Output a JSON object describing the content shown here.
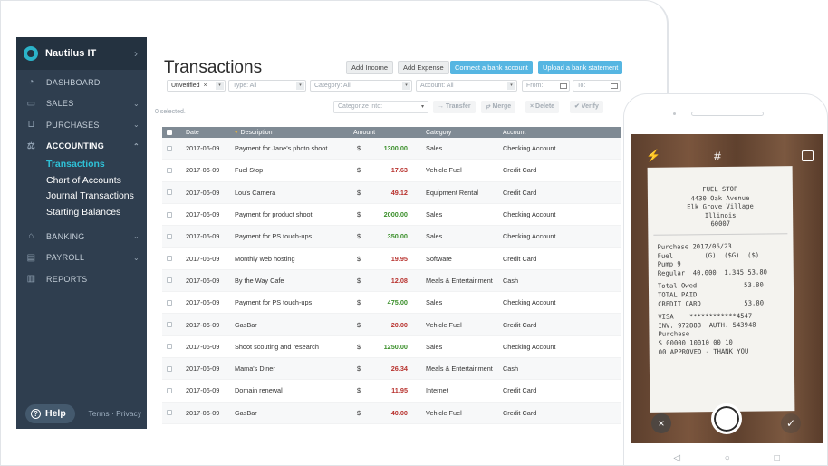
{
  "sidebar": {
    "org_name": "Nautilus IT",
    "nav": [
      {
        "label": "DASHBOARD"
      },
      {
        "label": "SALES"
      },
      {
        "label": "PURCHASES"
      },
      {
        "label": "ACCOUNTING"
      },
      {
        "label": "BANKING"
      },
      {
        "label": "PAYROLL"
      },
      {
        "label": "REPORTS"
      }
    ],
    "accounting_sub": [
      "Transactions",
      "Chart of Accounts",
      "Journal Transactions",
      "Starting Balances"
    ],
    "help_label": "Help",
    "footer_links": "Terms · Privacy"
  },
  "main": {
    "title": "Transactions",
    "buttons": {
      "add_income": "Add Income",
      "add_expense": "Add Expense",
      "connect": "Connect a bank account",
      "upload": "Upload a bank statement"
    },
    "filters": {
      "status": "Unverified",
      "type": "Type: All",
      "category": "Category: All",
      "account": "Account: All",
      "from": "From:",
      "to": "To:"
    },
    "selected_text": "0 selected.",
    "categorize_placeholder": "Categorize into:",
    "bulk_actions": {
      "transfer": "Transfer",
      "merge": "Merge",
      "delete": "Delete",
      "verify": "Verify"
    },
    "columns": [
      "Date",
      "Description",
      "Amount",
      "Category",
      "Account"
    ],
    "rows": [
      {
        "date": "2017-06-09",
        "desc": "Payment for Jane's photo shoot",
        "cur": "$",
        "amount": "1300.00",
        "type": "pos",
        "category": "Sales",
        "account": "Checking Account"
      },
      {
        "date": "2017-06-09",
        "desc": "Fuel Stop",
        "cur": "$",
        "amount": "17.63",
        "type": "neg",
        "category": "Vehicle Fuel",
        "account": "Credit Card"
      },
      {
        "date": "2017-06-09",
        "desc": "Lou's Camera",
        "cur": "$",
        "amount": "49.12",
        "type": "neg",
        "category": "Equipment Rental",
        "account": "Credit Card"
      },
      {
        "date": "2017-06-09",
        "desc": "Payment for product shoot",
        "cur": "$",
        "amount": "2000.00",
        "type": "pos",
        "category": "Sales",
        "account": "Checking Account"
      },
      {
        "date": "2017-06-09",
        "desc": "Payment for PS touch-ups",
        "cur": "$",
        "amount": "350.00",
        "type": "pos",
        "category": "Sales",
        "account": "Checking Account"
      },
      {
        "date": "2017-06-09",
        "desc": "Monthly web hosting",
        "cur": "$",
        "amount": "19.95",
        "type": "neg",
        "category": "Software",
        "account": "Credit Card"
      },
      {
        "date": "2017-06-09",
        "desc": "By the Way Cafe",
        "cur": "$",
        "amount": "12.08",
        "type": "neg",
        "category": "Meals & Entertainment",
        "account": "Cash"
      },
      {
        "date": "2017-06-09",
        "desc": "Payment for PS touch-ups",
        "cur": "$",
        "amount": "475.00",
        "type": "pos",
        "category": "Sales",
        "account": "Checking Account"
      },
      {
        "date": "2017-06-09",
        "desc": "GasBar",
        "cur": "$",
        "amount": "20.00",
        "type": "neg",
        "category": "Vehicle Fuel",
        "account": "Credit Card"
      },
      {
        "date": "2017-06-09",
        "desc": "Shoot scouting and research",
        "cur": "$",
        "amount": "1250.00",
        "type": "pos",
        "category": "Sales",
        "account": "Checking Account"
      },
      {
        "date": "2017-06-09",
        "desc": "Mama's Diner",
        "cur": "$",
        "amount": "26.34",
        "type": "neg",
        "category": "Meals & Entertainment",
        "account": "Cash"
      },
      {
        "date": "2017-06-09",
        "desc": "Domain renewal",
        "cur": "$",
        "amount": "11.95",
        "type": "neg",
        "category": "Internet",
        "account": "Credit Card"
      },
      {
        "date": "2017-06-09",
        "desc": "GasBar",
        "cur": "$",
        "amount": "40.00",
        "type": "neg",
        "category": "Vehicle Fuel",
        "account": "Credit Card"
      }
    ]
  },
  "receipt": {
    "header": [
      "FUEL STOP",
      "4430 Oak Avenue",
      "Elk Grove Village",
      "Illinois",
      "60007"
    ],
    "body": [
      "Purchase 2017/06/23",
      "Fuel        (G)  ($G)  ($)",
      "Pump 9",
      "Regular  40.000  1.345 53.80",
      "",
      "Total Owed            53.80",
      "TOTAL PAID",
      "CREDIT CARD           53.80",
      "",
      "VISA    ************4547",
      "INV. 972888  AUTH. 543948",
      "Purchase",
      "S 00000 10010 00 10",
      "00 APPROVED - THANK YOU"
    ]
  },
  "colors": {
    "sidebar": "#2f3e4f",
    "accent": "#2fc0d6",
    "blue_button": "#56b6e2",
    "positive": "#3a8f2a",
    "negative": "#b8322e"
  }
}
